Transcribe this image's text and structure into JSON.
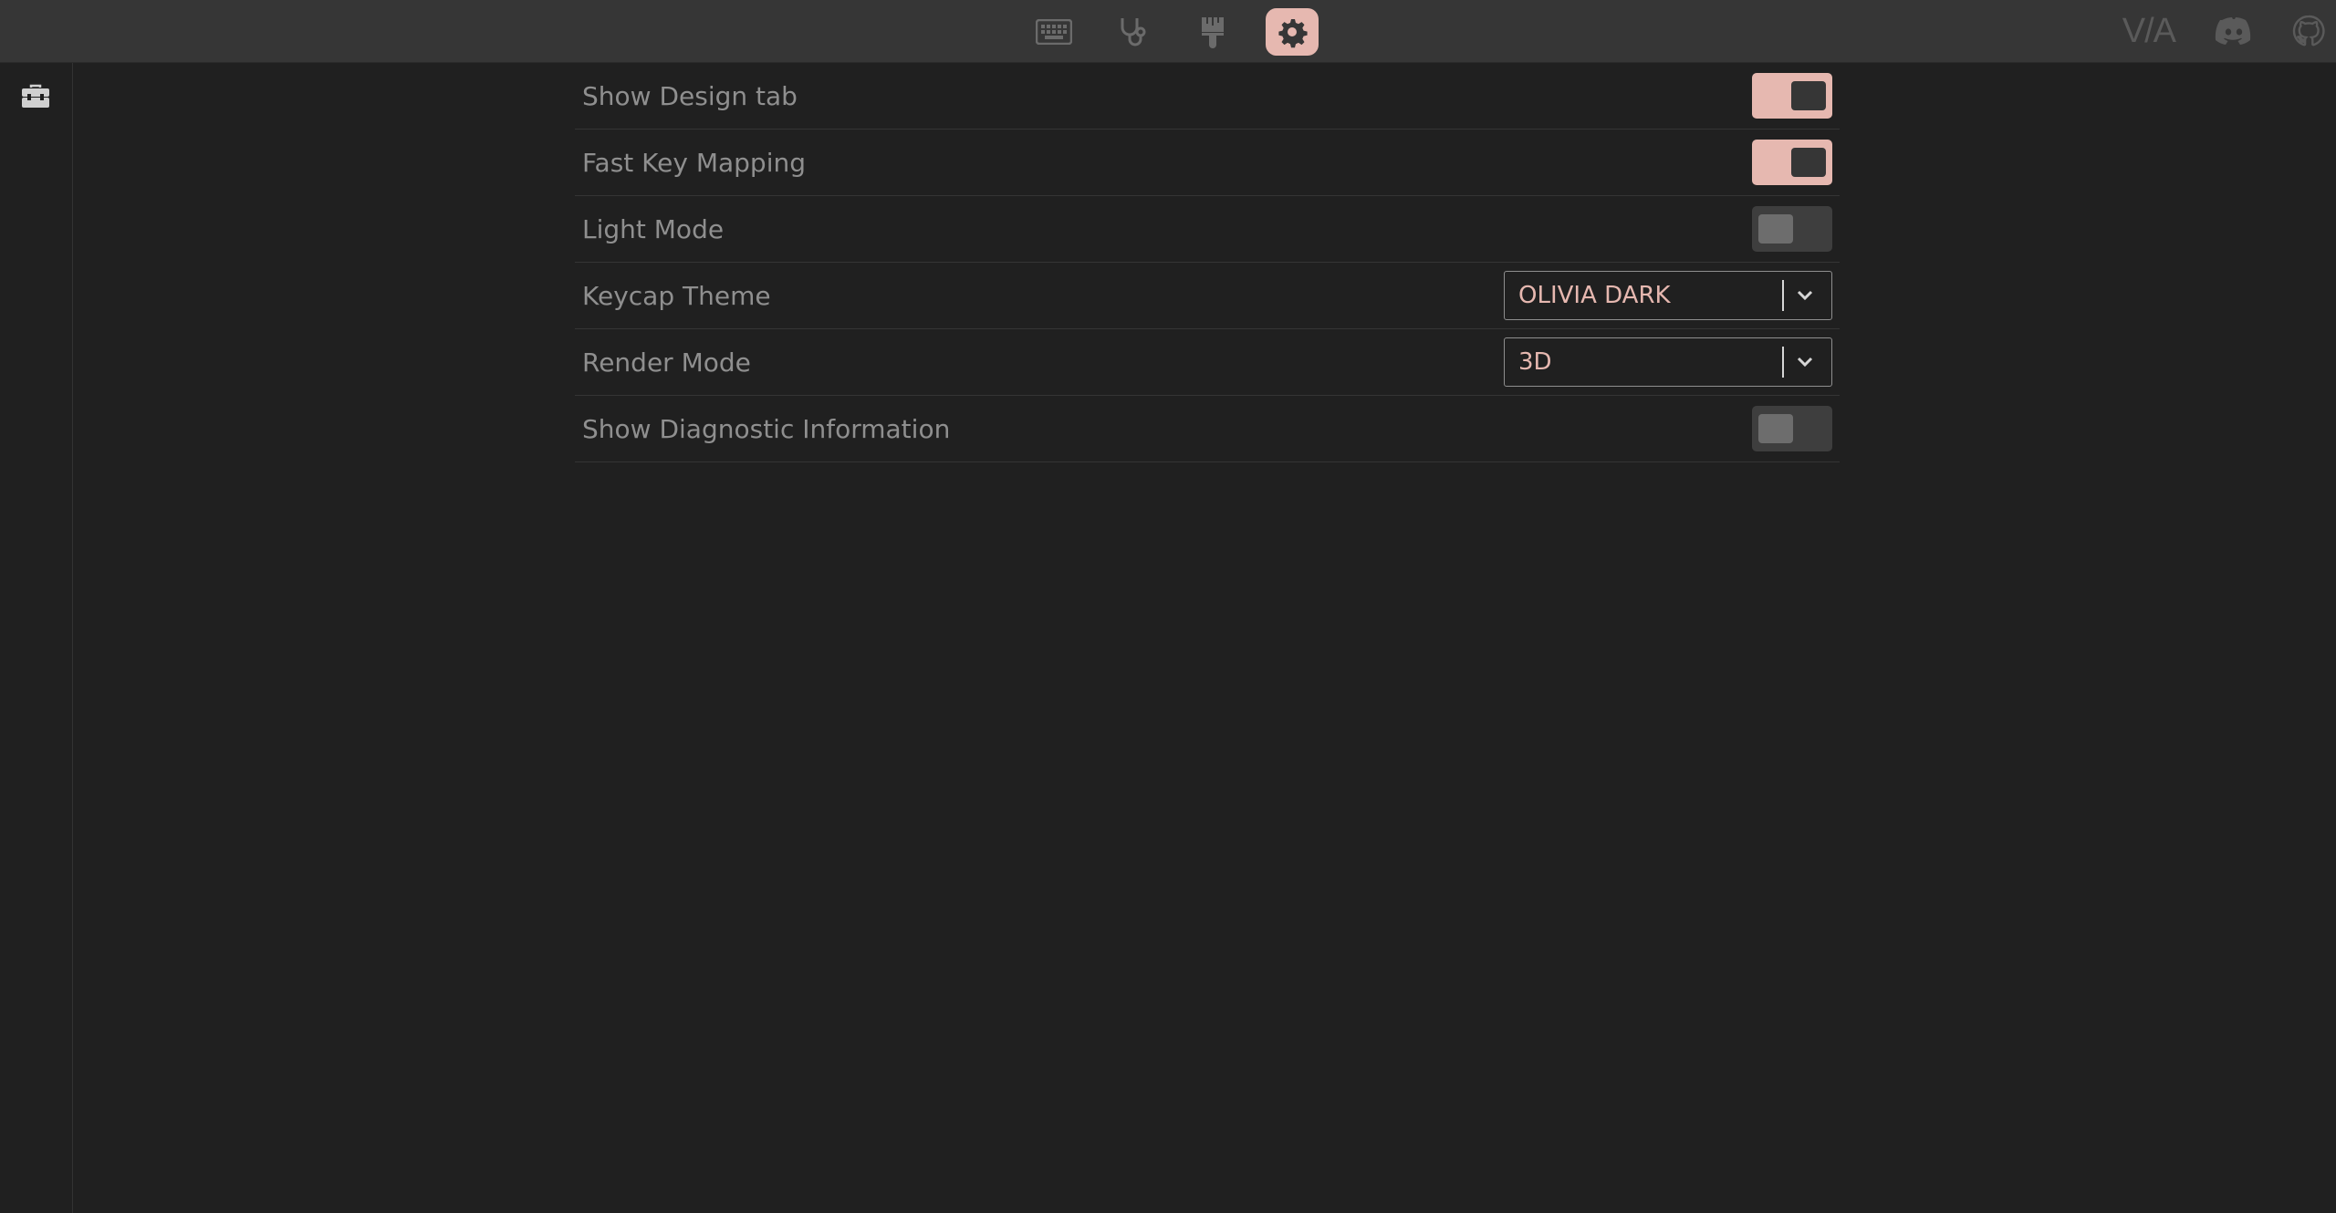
{
  "topbar": {
    "nav": [
      {
        "name": "keyboard",
        "icon": "keyboard-icon",
        "active": false
      },
      {
        "name": "test",
        "icon": "stethoscope-icon",
        "active": false
      },
      {
        "name": "design",
        "icon": "paintbrush-icon",
        "active": false
      },
      {
        "name": "settings",
        "icon": "gear-icon",
        "active": true
      }
    ],
    "brand_logo": "V/A",
    "external": [
      {
        "icon": "discord-icon"
      },
      {
        "icon": "github-icon"
      }
    ]
  },
  "sidebar": {
    "items": [
      {
        "icon": "toolbox-icon"
      }
    ]
  },
  "settings": {
    "rows": [
      {
        "label": "Show Design tab",
        "control": "toggle",
        "value": true
      },
      {
        "label": "Fast Key Mapping",
        "control": "toggle",
        "value": true
      },
      {
        "label": "Light Mode",
        "control": "toggle",
        "value": false
      },
      {
        "label": "Keycap Theme",
        "control": "select",
        "value": "OLIVIA DARK"
      },
      {
        "label": "Render Mode",
        "control": "select",
        "value": "3D"
      },
      {
        "label": "Show Diagnostic Information",
        "control": "toggle",
        "value": false
      }
    ]
  },
  "colors": {
    "accent": "#e6b8b0",
    "background": "#202020",
    "topbar": "#363636",
    "text_muted": "#8f8f8f"
  }
}
